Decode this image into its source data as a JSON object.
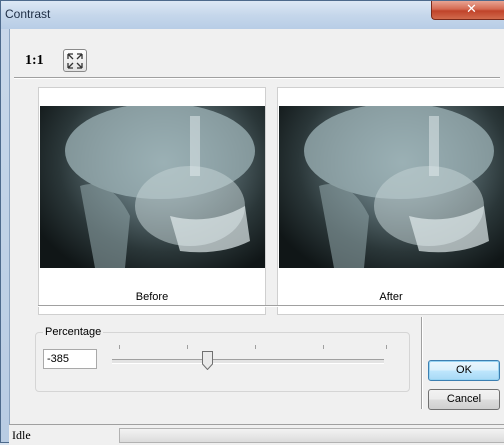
{
  "window": {
    "title": "Contrast",
    "close_glyph": "✕"
  },
  "toolbar": {
    "zoom_label": "1:1",
    "fit_icon": "fit-to-window-icon"
  },
  "preview": {
    "before_label": "Before",
    "after_label": "After"
  },
  "percentage": {
    "group_label": "Percentage",
    "value": "-385",
    "slider_position_fraction": 0.35
  },
  "buttons": {
    "ok_label": "OK",
    "cancel_label": "Cancel"
  },
  "status": {
    "text": "Idle"
  },
  "colors": {
    "close_button": "#c8472e",
    "default_button_border": "#3c7fb1"
  }
}
